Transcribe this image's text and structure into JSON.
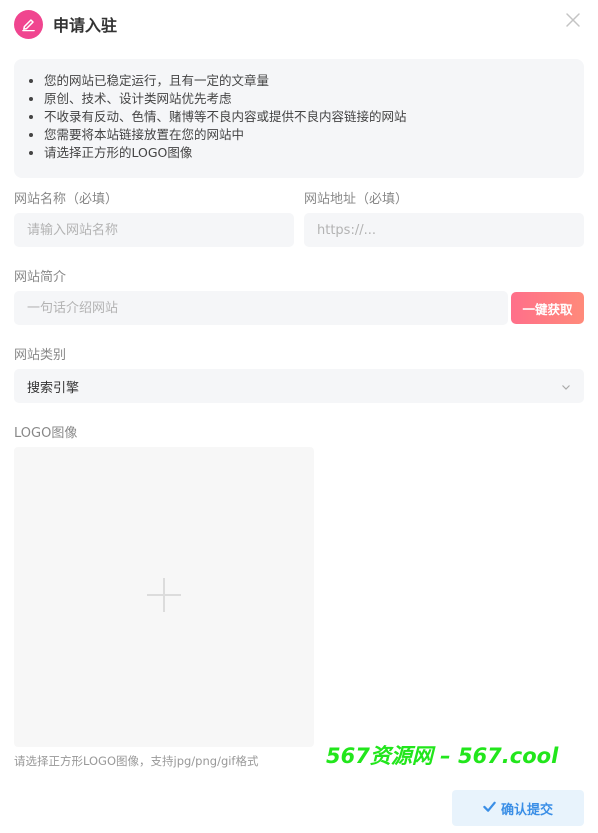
{
  "dialog": {
    "title": "申请入驻",
    "header_icon": "edit-icon",
    "close_icon": "close-icon",
    "accent_color": "#f0458f"
  },
  "notice": {
    "items": [
      "您的网站已稳定运行，且有一定的文章量",
      "原创、技术、设计类网站优先考虑",
      "不收录有反动、色情、赌博等不良内容或提供不良内容链接的网站",
      "您需要将本站链接放置在您的网站中",
      "请选择正方形的LOGO图像"
    ]
  },
  "form": {
    "site_name": {
      "label": "网站名称（必填）",
      "placeholder": "请输入网站名称",
      "value": ""
    },
    "site_url": {
      "label": "网站地址（必填）",
      "placeholder": "https://...",
      "value": ""
    },
    "site_desc": {
      "label": "网站简介",
      "placeholder": "一句话介绍网站",
      "value": "",
      "fetch_label": "一键获取"
    },
    "category": {
      "label": "网站类别",
      "selected": "搜索引擎",
      "icon": "chevron-down-icon"
    },
    "logo": {
      "label": "LOGO图像",
      "icon": "plus-icon",
      "hint": "请选择正方形LOGO图像，支持jpg/png/gif格式"
    }
  },
  "watermark": "567资源网 – 567.cool",
  "submit": {
    "label": "确认提交",
    "icon": "check-icon",
    "color": "#3a8ee6"
  }
}
